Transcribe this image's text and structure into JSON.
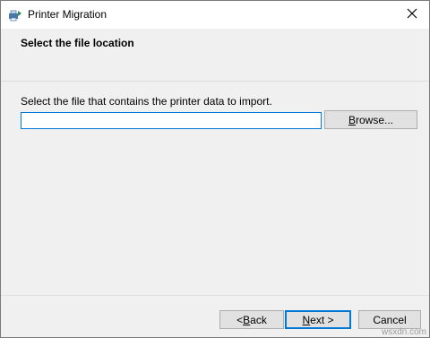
{
  "window": {
    "title": "Printer Migration"
  },
  "header": {
    "title": "Select the file location"
  },
  "form": {
    "prompt": "Select the file that contains the printer data to import.",
    "path_value": "",
    "browse_label_accel": "B",
    "browse_label_rest": "rowse..."
  },
  "footer": {
    "back_prefix": "< ",
    "back_accel": "B",
    "back_rest": "ack",
    "next_accel": "N",
    "next_rest": "ext >",
    "cancel_label": "Cancel"
  },
  "watermark": "wsxdn.com",
  "icons": {
    "app": "printer-migration-icon",
    "close": "close-icon"
  },
  "colors": {
    "accent": "#0078d7",
    "title_bar": "#ffffff",
    "background": "#f0f0f0"
  }
}
